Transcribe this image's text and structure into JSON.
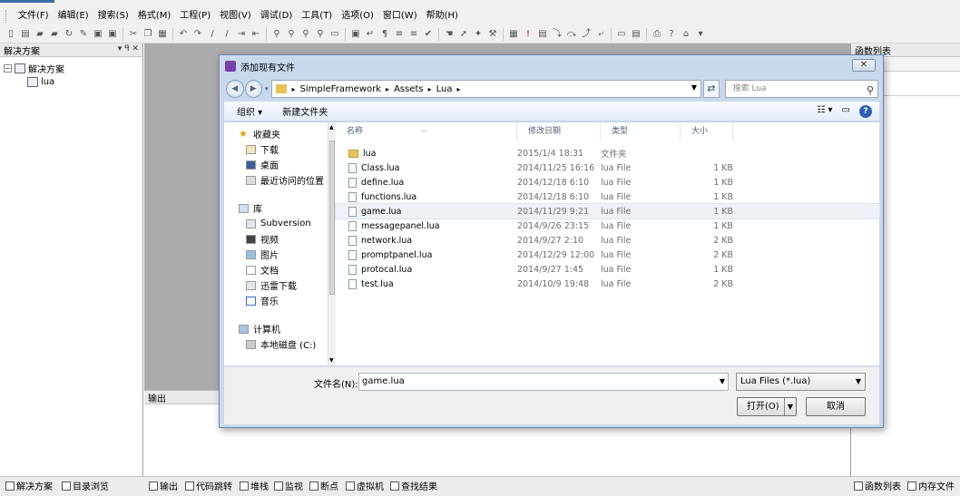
{
  "menu": [
    "文件(F)",
    "编辑(E)",
    "搜索(S)",
    "格式(M)",
    "工程(P)",
    "视图(V)",
    "调试(D)",
    "工具(T)",
    "选项(O)",
    "窗口(W)",
    "帮助(H)"
  ],
  "left_panel": {
    "title": "解决方案",
    "ctrl_pin": "▾ ꟼ ✕",
    "tree": [
      {
        "label": "解决方案",
        "expander": "⊟"
      },
      {
        "label": "lua"
      }
    ]
  },
  "right_panel": {
    "title": "函数列表"
  },
  "output_panel": {
    "title": "输出"
  },
  "statusbar": {
    "left": [
      "解决方案",
      "目录浏览"
    ],
    "middle": [
      "输出",
      "代码跳转",
      "堆栈",
      "监视",
      "断点",
      "虚拟机",
      "查找结果"
    ],
    "right": [
      "函数列表",
      "内存文件"
    ]
  },
  "dialog": {
    "title": "添加现有文件",
    "close_glyph": "✕",
    "breadcrumb": [
      "SimpleFramework",
      "Assets",
      "Lua"
    ],
    "search_placeholder": "搜索 Lua",
    "organize": "组织 ▾",
    "new_folder": "新建文件夹",
    "help_glyph": "?",
    "nav": {
      "favorites": "收藏夹",
      "fav_items": [
        "下载",
        "桌面",
        "最近访问的位置"
      ],
      "library": "库",
      "lib_items": [
        "Subversion",
        "视频",
        "图片",
        "文档",
        "迅雷下载",
        "音乐"
      ],
      "computer": "计算机",
      "drive": "本地磁盘 (C:)"
    },
    "columns": [
      "名称",
      "修改日期",
      "类型",
      "大小"
    ],
    "files": [
      {
        "name": "lua",
        "date": "2015/1/4 18:31",
        "type": "文件夹",
        "size": "",
        "dir": true
      },
      {
        "name": "Class.lua",
        "date": "2014/11/25 16:16",
        "type": "lua File",
        "size": "1 KB"
      },
      {
        "name": "define.lua",
        "date": "2014/12/18 6:10",
        "type": "lua File",
        "size": "1 KB"
      },
      {
        "name": "functions.lua",
        "date": "2014/12/18 6:10",
        "type": "lua File",
        "size": "1 KB"
      },
      {
        "name": "game.lua",
        "date": "2014/11/29 9:21",
        "type": "lua File",
        "size": "1 KB",
        "selected": true
      },
      {
        "name": "messagepanel.lua",
        "date": "2014/9/26 23:15",
        "type": "lua File",
        "size": "1 KB"
      },
      {
        "name": "network.lua",
        "date": "2014/9/27 2:10",
        "type": "lua File",
        "size": "2 KB"
      },
      {
        "name": "promptpanel.lua",
        "date": "2014/12/29 12:00",
        "type": "lua File",
        "size": "2 KB"
      },
      {
        "name": "protocal.lua",
        "date": "2014/9/27 1:45",
        "type": "lua File",
        "size": "1 KB"
      },
      {
        "name": "test.lua",
        "date": "2014/10/9 19:48",
        "type": "lua File",
        "size": "2 KB"
      }
    ],
    "filename_label": "文件名(N):",
    "filename_value": "game.lua",
    "filetype": "Lua Files (*.lua)",
    "open_button": "打开(O)",
    "cancel_button": "取消"
  }
}
